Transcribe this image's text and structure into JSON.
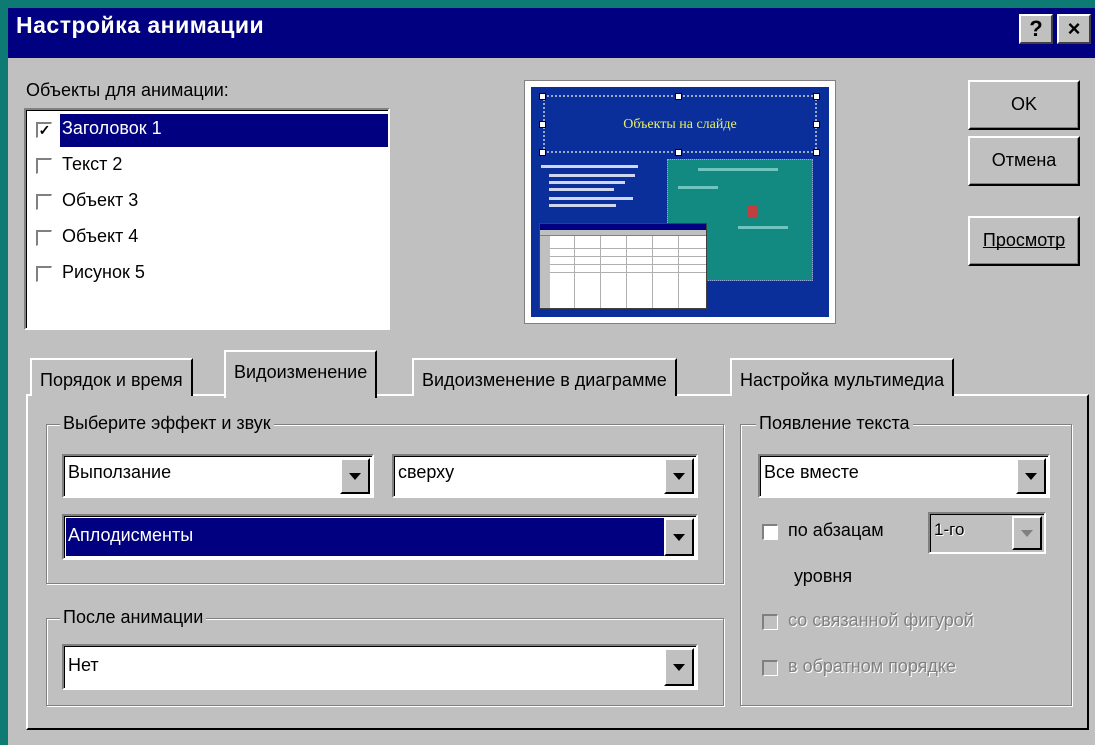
{
  "window": {
    "title": "Настройка анимации",
    "help_label": "?",
    "close_label": "×"
  },
  "objects": {
    "label": "Объекты для анимации:",
    "items": [
      {
        "label": "Заголовок 1",
        "checked": true,
        "selected": true
      },
      {
        "label": "Текст 2",
        "checked": false
      },
      {
        "label": "Объект 3",
        "checked": false
      },
      {
        "label": "Объект 4",
        "checked": false
      },
      {
        "label": "Рисунок 5",
        "checked": false
      }
    ]
  },
  "preview": {
    "slide_title": "Объекты на слайде"
  },
  "buttons": {
    "ok": "OK",
    "cancel": "Отмена",
    "preview": "Просмотр"
  },
  "tabs": [
    {
      "label": "Порядок и время",
      "active": false
    },
    {
      "label": "Видоизменение",
      "active": true
    },
    {
      "label": "Видоизменение в диаграмме",
      "active": false
    },
    {
      "label": "Настройка мультимедиа",
      "active": false
    }
  ],
  "effect_group": {
    "label": "Выберите эффект и звук",
    "effect": "Выползание",
    "direction": "сверху",
    "sound": "Аплодисменты"
  },
  "after_group": {
    "label": "После анимации",
    "value": "Нет"
  },
  "text_group": {
    "label": "Появление текста",
    "mode": "Все вместе",
    "by_paragraph_label": "по абзацам",
    "level_value": "1-го",
    "level_suffix": "уровня",
    "linked_shape_label": "со связанной фигурой",
    "reverse_order_label": "в обратном порядке"
  },
  "colors": {
    "title_bar": "#000080",
    "selection": "#000080",
    "face": "#c0c0c0",
    "desktop": "#0e7a74"
  }
}
